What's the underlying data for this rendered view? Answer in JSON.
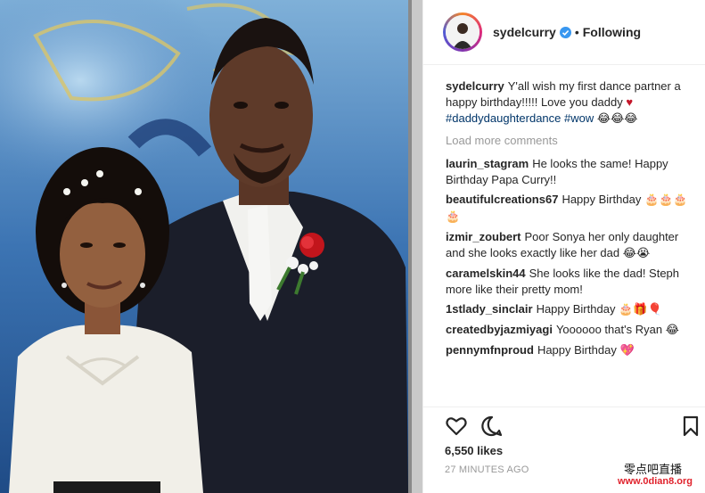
{
  "photo": {
    "description_icon": "photo"
  },
  "header": {
    "username": "sydelcurry",
    "verified_icon": "verified-badge-icon",
    "separator": "•",
    "follow_status": "Following"
  },
  "caption": {
    "username": "sydelcurry",
    "text": "Y'all wish my first dance partner a happy birthday!!!!! Love you daddy",
    "heart": "♥",
    "hashtags": "#daddydaughterdance #wow",
    "emojis": "😂😂😂"
  },
  "load_more": "Load more comments",
  "comments": [
    {
      "username": "laurin_stagram",
      "text": "He looks the same! Happy Birthday Papa Curry!!",
      "emoji": ""
    },
    {
      "username": "beautifulcreations67",
      "text": "Happy Birthday",
      "emoji": "🎂🎂🎂🎂"
    },
    {
      "username": "izmir_zoubert",
      "text": "Poor Sonya her only daughter and she looks exactly like her dad",
      "emoji": "😂😭"
    },
    {
      "username": "caramelskin44",
      "text": "She looks like the dad! Steph more like their pretty mom!",
      "emoji": ""
    },
    {
      "username": "1stlady_sinclair",
      "text": "Happy Birthday",
      "emoji": "🎂🎁🎈"
    },
    {
      "username": "createdbyjazmiyagi",
      "text": "Yoooooo that's Ryan",
      "emoji": "😂"
    },
    {
      "username": "pennymfnproud",
      "text": "Happy Birthday",
      "emoji": "💖"
    }
  ],
  "actions": {
    "like_icon": "heart-outline-icon",
    "comment_icon": "comment-bubble-icon",
    "save_icon": "bookmark-icon"
  },
  "likes": "6,550 likes",
  "time_ago": "27 MINUTES AGO",
  "watermark": {
    "chinese": "零点吧直播",
    "url": "www.0dian8.org"
  }
}
